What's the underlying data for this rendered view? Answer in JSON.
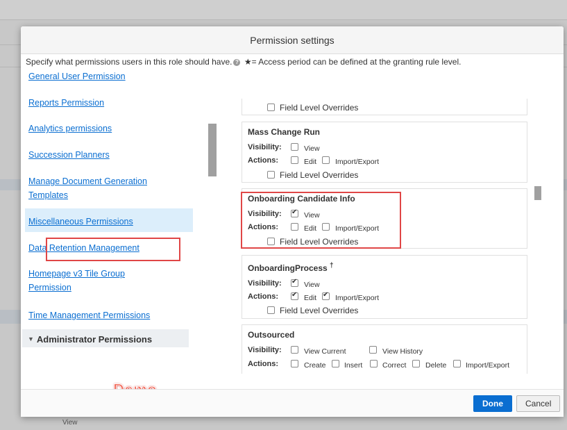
{
  "dialog": {
    "title": "Permission settings",
    "instructions": "Specify what permissions users in this role should have.",
    "access_note": "★= Access period can be defined at the granting rule level.",
    "done_label": "Done",
    "cancel_label": "Cancel"
  },
  "nav": {
    "items": [
      {
        "label": "General User Permission"
      },
      {
        "label": "Reports Permission"
      },
      {
        "label": "Analytics permissions"
      },
      {
        "label": "Succession Planners"
      },
      {
        "label": "Manage Document Generation Templates"
      },
      {
        "label": "Miscellaneous Permissions"
      },
      {
        "label": "Data Retention Management"
      },
      {
        "label": "Homepage v3 Tile Group Permission"
      },
      {
        "label": "Time Management Permissions"
      }
    ],
    "group_label": "Administrator Permissions"
  },
  "perms": {
    "top_partial": {
      "flo": "Field Level Overrides"
    },
    "mass_change": {
      "title": "Mass Change Run",
      "visibility_label": "Visibility:",
      "actions_label": "Actions:",
      "view": "View",
      "edit": "Edit",
      "import": "Import/Export",
      "flo": "Field Level Overrides"
    },
    "onboarding_candidate": {
      "title": "Onboarding Candidate Info",
      "visibility_label": "Visibility:",
      "actions_label": "Actions:",
      "view": "View",
      "edit": "Edit",
      "import": "Import/Export",
      "flo": "Field Level Overrides"
    },
    "onboarding_process": {
      "title": "OnboardingProcess",
      "dagger": "†",
      "visibility_label": "Visibility:",
      "actions_label": "Actions:",
      "view": "View",
      "edit": "Edit",
      "import": "Import/Export",
      "flo": "Field Level Overrides"
    },
    "outsourced": {
      "title": "Outsourced",
      "visibility_label": "Visibility:",
      "actions_label": "Actions:",
      "view_current": "View Current",
      "view_history": "View History",
      "create": "Create",
      "insert": "Insert",
      "correct": "Correct",
      "delete": "Delete",
      "import": "Import/Export"
    }
  },
  "overlay": {
    "demo": "Demo"
  },
  "background": {
    "view": "View"
  },
  "colors": {
    "accent": "#0a6ed1",
    "highlight_red": "#e04646",
    "demo_text": "#f26b5b"
  }
}
